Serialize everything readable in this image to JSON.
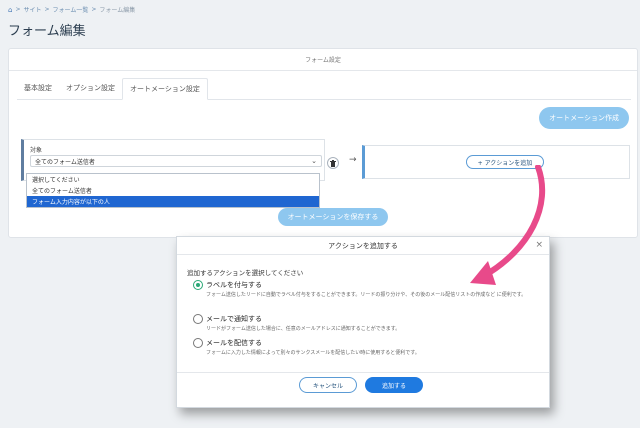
{
  "breadcrumb": {
    "home": "⌂",
    "items": [
      "サイト",
      "フォーム一覧",
      "フォーム編集"
    ],
    "sep": ">"
  },
  "page_title": "フォーム編集",
  "card": {
    "header": "フォーム設定"
  },
  "tabs": [
    "基本設定",
    "オプション設定",
    "オートメーション設定"
  ],
  "automation": {
    "create_button": "オートメーション作成",
    "target_label": "対象",
    "target_value": "全てのフォーム送信者",
    "dropdown_options": [
      "選択してください",
      "全てのフォーム送信者",
      "フォーム入力内容が以下の人"
    ],
    "add_action_button": "+ アクションを追加",
    "save_button": "オートメーションを保存する"
  },
  "modal": {
    "title": "アクションを追加する",
    "close": "×",
    "prompt": "追加するアクションを選択してください",
    "options": [
      {
        "label": "ラベルを付与する",
        "desc": "フォーム送信したリードに自動でラベル付与をすることができます。リードの振り分けや、その後のメール配信リストの作成など に便利です。",
        "selected": true
      },
      {
        "label": "メールで通知する",
        "desc": "リードがフォーム送信した場合に、任意のメールアドレスに通知することができます。",
        "selected": false
      },
      {
        "label": "メールを配信する",
        "desc": "フォームに入力した情報によって別々のサンクスメールを配信したい時に使用すると便利です。",
        "selected": false
      }
    ],
    "cancel_button": "キャンセル",
    "submit_button": "追加する"
  },
  "colors": {
    "accent": "#1f7ae0",
    "light_accent": "#8ec7ef",
    "annotation_arrow": "#e84a8a",
    "radio_selected": "#2aa876"
  }
}
